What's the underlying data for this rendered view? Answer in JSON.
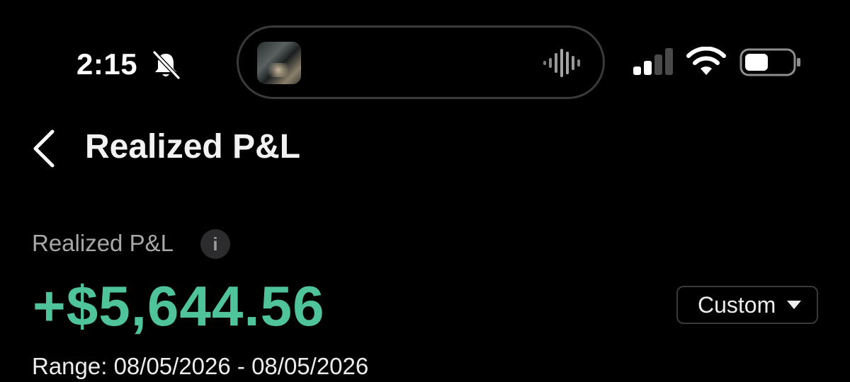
{
  "status_bar": {
    "time": "2:15",
    "icons": [
      "bell-slash-icon",
      "audio-waveform-icon",
      "cellular-signal-icon",
      "wifi-icon",
      "battery-icon"
    ]
  },
  "header": {
    "back_icon": "chevron-left-icon",
    "title": "Realized P&L"
  },
  "summary": {
    "label": "Realized P&L",
    "info_icon_glyph": "i",
    "value": "+$5,644.56",
    "value_color": "#4fc49a",
    "range_selector": {
      "selected": "Custom",
      "icon": "caret-down-icon"
    },
    "range_text": "Range: 08/05/2026 - 08/05/2026"
  }
}
